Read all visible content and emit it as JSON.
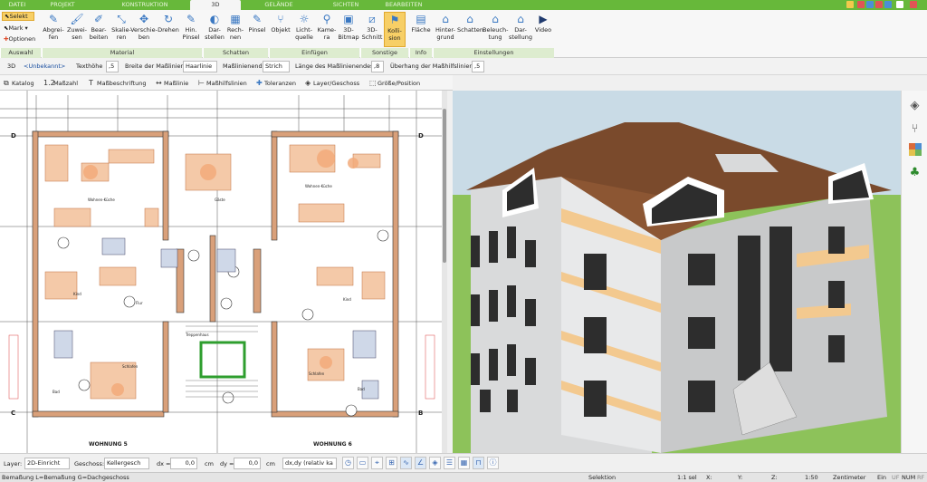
{
  "menu": {
    "tabs": [
      "DATEI",
      "PROJEKT",
      "KONSTRUKTION",
      "3D",
      "GELÄNDE",
      "SICHTEN",
      "BEARBEITEN"
    ],
    "active_tab": "3D"
  },
  "ribbon": {
    "auswahl": {
      "selekt": "Selekt",
      "mark": "Mark",
      "optionen": "Optionen",
      "group": "Auswahl"
    },
    "material": {
      "group": "Material",
      "buttons": [
        "Abgrei-\nfen",
        "Zuwei-\nsen",
        "Bear-\nbeiten",
        "Skalie-\nren",
        "Verschie-\nben",
        "Drehen",
        "Hin.\nPinsel"
      ]
    },
    "schatten": {
      "group": "Schatten",
      "buttons": [
        "Dar-\nstellen",
        "Rech-\nnen",
        "Pinsel"
      ]
    },
    "einfuegen": {
      "group": "Einfügen",
      "buttons": [
        "Objekt",
        "Licht-\nquelle",
        "Kame-\nra",
        "3D-\nBitmap"
      ]
    },
    "sonstige": {
      "group": "Sonstige",
      "buttons": [
        "3D-\nSchnitt",
        "Kolli-\nsion"
      ]
    },
    "info": {
      "group": "Info",
      "buttons": [
        "Fläche"
      ]
    },
    "einstellungen": {
      "group": "Einstellungen",
      "buttons": [
        "Hinter-\ngrund",
        "Schatten",
        "Beleuch-\ntung",
        "Dar-\nstellung",
        "Video"
      ]
    }
  },
  "dimension_bar": {
    "mode": "3D",
    "layer": "<Unbekannt>",
    "texthoehe_label": "Texthöhe",
    "texthoehe_value": ",5",
    "breite_label": "Breite der Maßlinien",
    "breite_value": "Haarlinie",
    "massende_label": "Maßlinienende",
    "massende_value": "Strich",
    "laenge_label": "Länge des Maßlinienendes",
    "laenge_value": ",8",
    "ueberhang_label": "Überhang der Maßhilfslinien",
    "ueberhang_value": ",5"
  },
  "toolbar2": [
    "Katalog",
    "Maßzahl",
    "Maßbeschriftung",
    "Maßlinie",
    "Maßhilfslinien",
    "Toleranzen",
    "Layer/Geschoss",
    "Größe/Position"
  ],
  "plan": {
    "labels": [
      "Wohnen-Küche",
      "Wohnen-Küche",
      "Gäste",
      "Kind",
      "Flur",
      "Kind",
      "Schlafen",
      "Bad",
      "Schlafen",
      "Bad",
      "Treppenhaus",
      "WOHNUNG 5",
      "WOHNUNG 6"
    ],
    "axis_labels": [
      "D",
      "D",
      "C",
      "B"
    ]
  },
  "bottom": {
    "layer_label": "Layer:",
    "layer_value": "2D-Einricht",
    "geschoss_label": "Geschoss:",
    "geschoss_value": "Kellergesch",
    "dx_label": "dx =",
    "dx_value": "0,0",
    "dx_unit": "cm",
    "dy_label": "dy =",
    "dy_value": "0,0",
    "dy_unit": "cm",
    "mode_value": "dx,dy (relativ ka"
  },
  "status": {
    "hint": "Bemaßung L=Bemaßung G=Dachgeschoss",
    "selection": "Selektion",
    "sel": "1:1 sel",
    "x_label": "X:",
    "y_label": "Y:",
    "z_label": "Z:",
    "scale": "1:50",
    "unit": "Zentimeter",
    "ein": "Ein",
    "uf": "UF",
    "num": "NUM",
    "rf": "RF"
  },
  "right_panel_icons": [
    "layers-icon",
    "furniture-icon",
    "material-palette-icon",
    "tree-icon"
  ],
  "colors": {
    "accent": "#67b83a",
    "roof": "#7a4a2c",
    "wall": "#d9dadb",
    "grass": "#8dc25a",
    "sky": "#c9dbe6"
  }
}
